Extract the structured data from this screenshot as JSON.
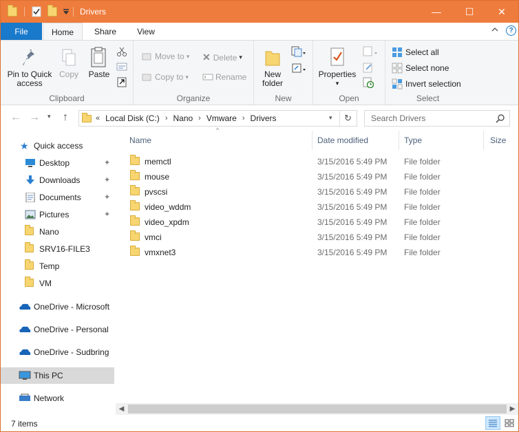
{
  "window": {
    "title": "Drivers",
    "colors": {
      "titlebar": "#ee7c3d",
      "file_tab": "#1979ca",
      "selected_nav": "#d9d9d9"
    },
    "caption_buttons": {
      "minimize": "—",
      "maximize": "☐",
      "close": "✕"
    }
  },
  "quick_access_toolbar": {
    "icons": [
      "folder-icon",
      "properties-check-icon",
      "new-folder-icon",
      "customize-dropdown-icon"
    ]
  },
  "ribbon_tabs": {
    "file": "File",
    "home": "Home",
    "share": "Share",
    "view": "View"
  },
  "ribbon": {
    "clipboard": {
      "label": "Clipboard",
      "pin": "Pin to Quick access",
      "copy": "Copy",
      "paste": "Paste"
    },
    "organize": {
      "label": "Organize",
      "move_to": "Move to",
      "copy_to": "Copy to",
      "delete": "Delete",
      "rename": "Rename"
    },
    "new": {
      "label": "New",
      "new_folder": "New folder"
    },
    "open": {
      "label": "Open",
      "properties": "Properties"
    },
    "select": {
      "label": "Select",
      "select_all": "Select all",
      "select_none": "Select none",
      "invert_selection": "Invert selection"
    }
  },
  "address_bar": {
    "overflow": "«",
    "crumbs": [
      "Local Disk (C:)",
      "Nano",
      "Vmware",
      "Drivers"
    ],
    "search_placeholder": "Search Drivers"
  },
  "sidebar": {
    "quick_access": {
      "label": "Quick access"
    },
    "items": [
      {
        "label": "Desktop",
        "icon": "desktop-icon",
        "pinned": true
      },
      {
        "label": "Downloads",
        "icon": "download-icon",
        "pinned": true
      },
      {
        "label": "Documents",
        "icon": "documents-icon",
        "pinned": true
      },
      {
        "label": "Pictures",
        "icon": "pictures-icon",
        "pinned": true
      },
      {
        "label": "Nano",
        "icon": "folder-icon",
        "pinned": false
      },
      {
        "label": "SRV16-FILE3",
        "icon": "folder-icon",
        "pinned": false
      },
      {
        "label": "Temp",
        "icon": "folder-icon",
        "pinned": false
      },
      {
        "label": "VM",
        "icon": "folder-icon",
        "pinned": false
      }
    ],
    "onedrive": [
      "OneDrive - Microsoft",
      "OneDrive - Personal",
      "OneDrive - Sudbring"
    ],
    "this_pc": "This PC",
    "network": "Network"
  },
  "columns": {
    "name": "Name",
    "date": "Date modified",
    "type": "Type",
    "size": "Size"
  },
  "files": [
    {
      "name": "memctl",
      "date": "3/15/2016 5:49 PM",
      "type": "File folder"
    },
    {
      "name": "mouse",
      "date": "3/15/2016 5:49 PM",
      "type": "File folder"
    },
    {
      "name": "pvscsi",
      "date": "3/15/2016 5:49 PM",
      "type": "File folder"
    },
    {
      "name": "video_wddm",
      "date": "3/15/2016 5:49 PM",
      "type": "File folder"
    },
    {
      "name": "video_xpdm",
      "date": "3/15/2016 5:49 PM",
      "type": "File folder"
    },
    {
      "name": "vmci",
      "date": "3/15/2016 5:49 PM",
      "type": "File folder"
    },
    {
      "name": "vmxnet3",
      "date": "3/15/2016 5:49 PM",
      "type": "File folder"
    }
  ],
  "status": {
    "item_count": "7 items"
  }
}
